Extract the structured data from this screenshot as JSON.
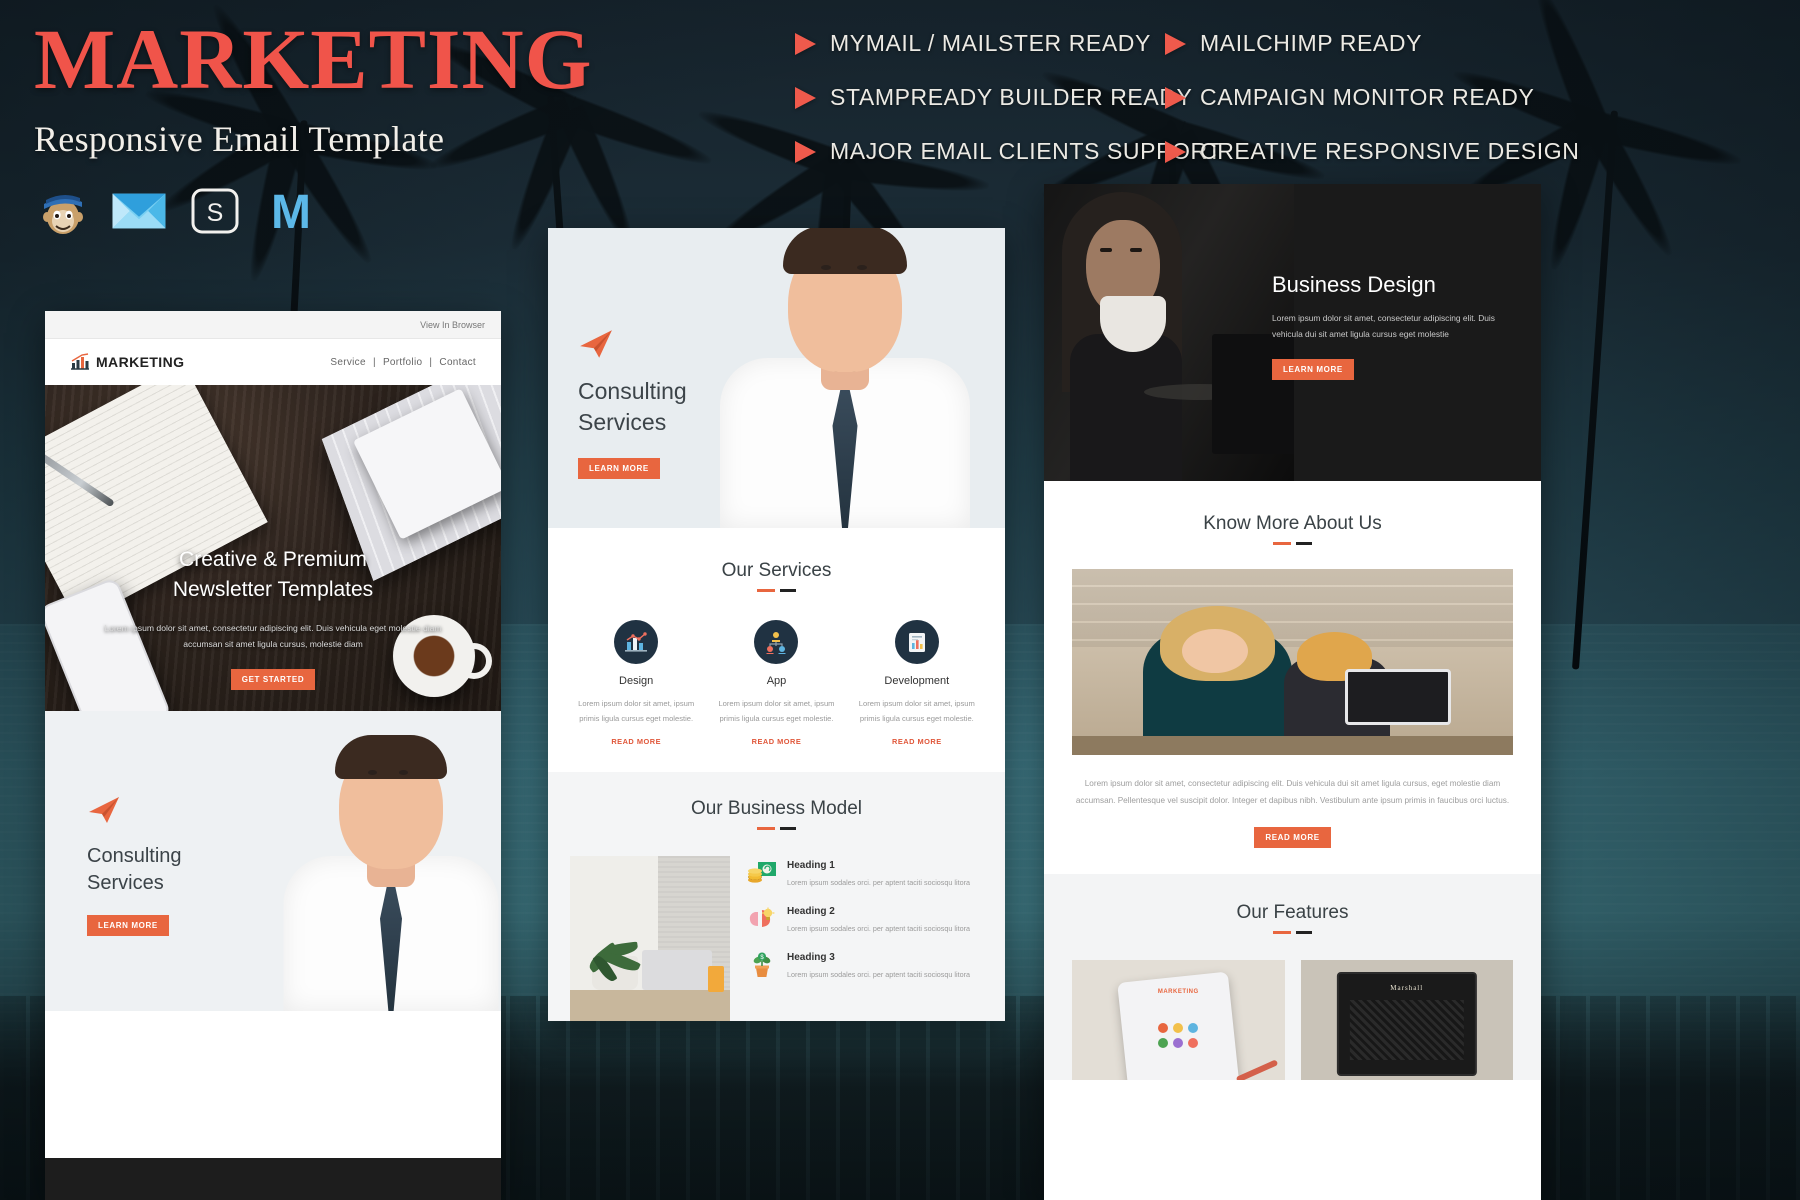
{
  "header": {
    "title": "MARKETING",
    "subtitle": "Responsive Email Template",
    "logos": [
      {
        "name": "mailchimp-icon",
        "label": "Mailchimp"
      },
      {
        "name": "mymail-icon",
        "label": "MyMail"
      },
      {
        "name": "stampready-icon",
        "label": "StampReady"
      },
      {
        "name": "mailster-icon",
        "label": "Mailster"
      }
    ]
  },
  "features": [
    "MYMAIL / MAILSTER READY",
    "MAILCHIMP READY",
    "STAMPREADY BUILDER READY",
    "CAMPAIGN MONITOR READY",
    "MAJOR EMAIL CLIENTS SUPPORT",
    "CREATIVE RESPONSIVE DESIGN"
  ],
  "colors": {
    "accent_red": "#f0544a",
    "accent_orange": "#e8663f",
    "dark_navy": "#203242",
    "background": "#152028"
  },
  "panel_left": {
    "view_in_browser": "View In Browser",
    "brand": "MARKETING",
    "nav": [
      "Service",
      "Portfolio",
      "Contact"
    ],
    "nav_separator": "|",
    "hero_heading_line1": "Creative & Premium",
    "hero_heading_line2": "Newsletter Templates",
    "hero_paragraph": "Lorem ipsum dolor sit amet, consectetur adipiscing elit. Duis vehicula eget molestie diam accumsan sit amet ligula cursus, molestie diam",
    "hero_button": "GET STARTED",
    "consulting_heading_line1": "Consulting",
    "consulting_heading_line2": "Services",
    "consulting_button": "LEARN MORE"
  },
  "panel_mid": {
    "hero_heading_line1": "Consulting",
    "hero_heading_line2": "Services",
    "hero_button": "LEARN MORE",
    "services_title": "Our Services",
    "services": [
      {
        "icon": "bar-chart-icon",
        "name": "Design",
        "desc": "Lorem ipsum dolor sit amet, ipsum primis ligula cursus eget molestie.",
        "link": "READ MORE"
      },
      {
        "icon": "team-network-icon",
        "name": "App",
        "desc": "Lorem ipsum dolor sit amet, ipsum primis ligula cursus eget molestie.",
        "link": "READ MORE"
      },
      {
        "icon": "document-chart-icon",
        "name": "Development",
        "desc": "Lorem ipsum dolor sit amet, ipsum primis ligula cursus eget molestie.",
        "link": "READ MORE"
      }
    ],
    "business_model_title": "Our Business Model",
    "business_items": [
      {
        "icon": "money-coins-icon",
        "heading": "Heading 1",
        "desc": "Lorem ipsum sodales orci. per aptent taciti sociosqu litora"
      },
      {
        "icon": "brain-idea-icon",
        "heading": "Heading 2",
        "desc": "Lorem ipsum sodales orci. per aptent taciti sociosqu litora"
      },
      {
        "icon": "money-plant-icon",
        "heading": "Heading 3",
        "desc": "Lorem ipsum sodales orci. per aptent taciti sociosqu litora"
      }
    ]
  },
  "panel_right": {
    "hero_heading": "Business Design",
    "hero_paragraph": "Lorem ipsum dolor sit amet, consectetur adipiscing elit. Duis vehicula dui sit amet ligula cursus eget molestie",
    "hero_button": "LEARN MORE",
    "know_title": "Know More About Us",
    "know_paragraph": "Lorem ipsum dolor sit amet, consectetur adipiscing elit. Duis vehicula dui sit amet ligula cursus, eget molestie diam accumsan. Pellentesque vel suscipit dolor. Integer et dapibus nibh. Vestibulum ante ipsum primis in faucibus orci luctus.",
    "know_button": "READ MORE",
    "features_title": "Our Features"
  }
}
